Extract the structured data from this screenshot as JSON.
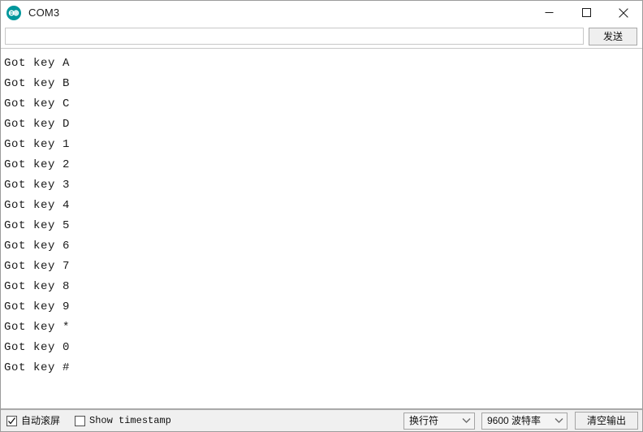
{
  "window": {
    "title": "COM3",
    "app_icon": "arduino-logo-icon",
    "accent_color": "#00979c",
    "controls": {
      "minimize_label": "Minimize",
      "maximize_label": "Maximize",
      "close_label": "Close"
    }
  },
  "send_row": {
    "input_value": "",
    "input_placeholder": "",
    "send_label": "发送"
  },
  "console": {
    "lines": [
      "Got key A",
      "Got key B",
      "Got key C",
      "Got key D",
      "Got key 1",
      "Got key 2",
      "Got key 3",
      "Got key 4",
      "Got key 5",
      "Got key 6",
      "Got key 7",
      "Got key 8",
      "Got key 9",
      "Got key *",
      "Got key 0",
      "Got key #"
    ]
  },
  "status_bar": {
    "autoscroll": {
      "label": "自动滚屏",
      "checked": true
    },
    "timestamp": {
      "label": "Show timestamp",
      "checked": false
    },
    "line_ending": {
      "selected": "换行符"
    },
    "baud_rate": {
      "selected": "9600 波特率"
    },
    "clear_label": "清空输出"
  }
}
